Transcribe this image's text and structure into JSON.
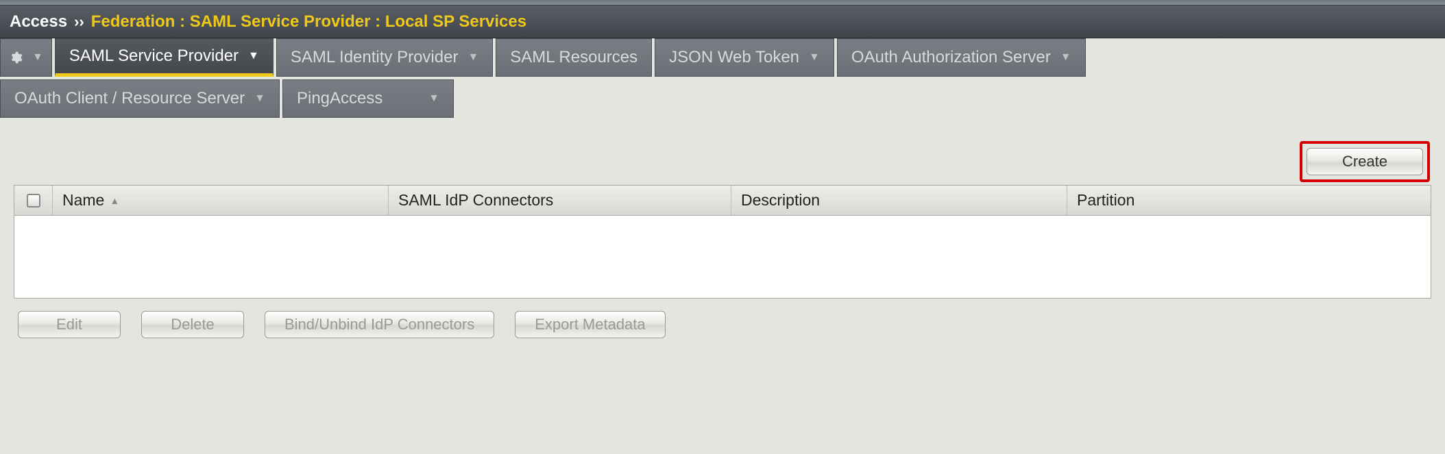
{
  "breadcrumb": {
    "root": "Access",
    "separator": "››",
    "path": "Federation : SAML Service Provider : Local SP Services"
  },
  "tabs_row1": [
    {
      "label": "SAML Service Provider",
      "active": true,
      "dropdown": true
    },
    {
      "label": "SAML Identity Provider",
      "active": false,
      "dropdown": true
    },
    {
      "label": "SAML Resources",
      "active": false,
      "dropdown": false
    },
    {
      "label": "JSON Web Token",
      "active": false,
      "dropdown": true
    },
    {
      "label": "OAuth Authorization Server",
      "active": false,
      "dropdown": true
    }
  ],
  "tabs_row2": [
    {
      "label": "OAuth Client / Resource Server",
      "active": false,
      "dropdown": true
    },
    {
      "label": "PingAccess",
      "active": false,
      "dropdown": true
    }
  ],
  "buttons": {
    "create": "Create",
    "edit": "Edit",
    "delete": "Delete",
    "bind": "Bind/Unbind IdP Connectors",
    "export": "Export Metadata"
  },
  "table": {
    "columns": {
      "name": "Name",
      "connectors": "SAML IdP Connectors",
      "description": "Description",
      "partition": "Partition"
    },
    "rows": []
  }
}
